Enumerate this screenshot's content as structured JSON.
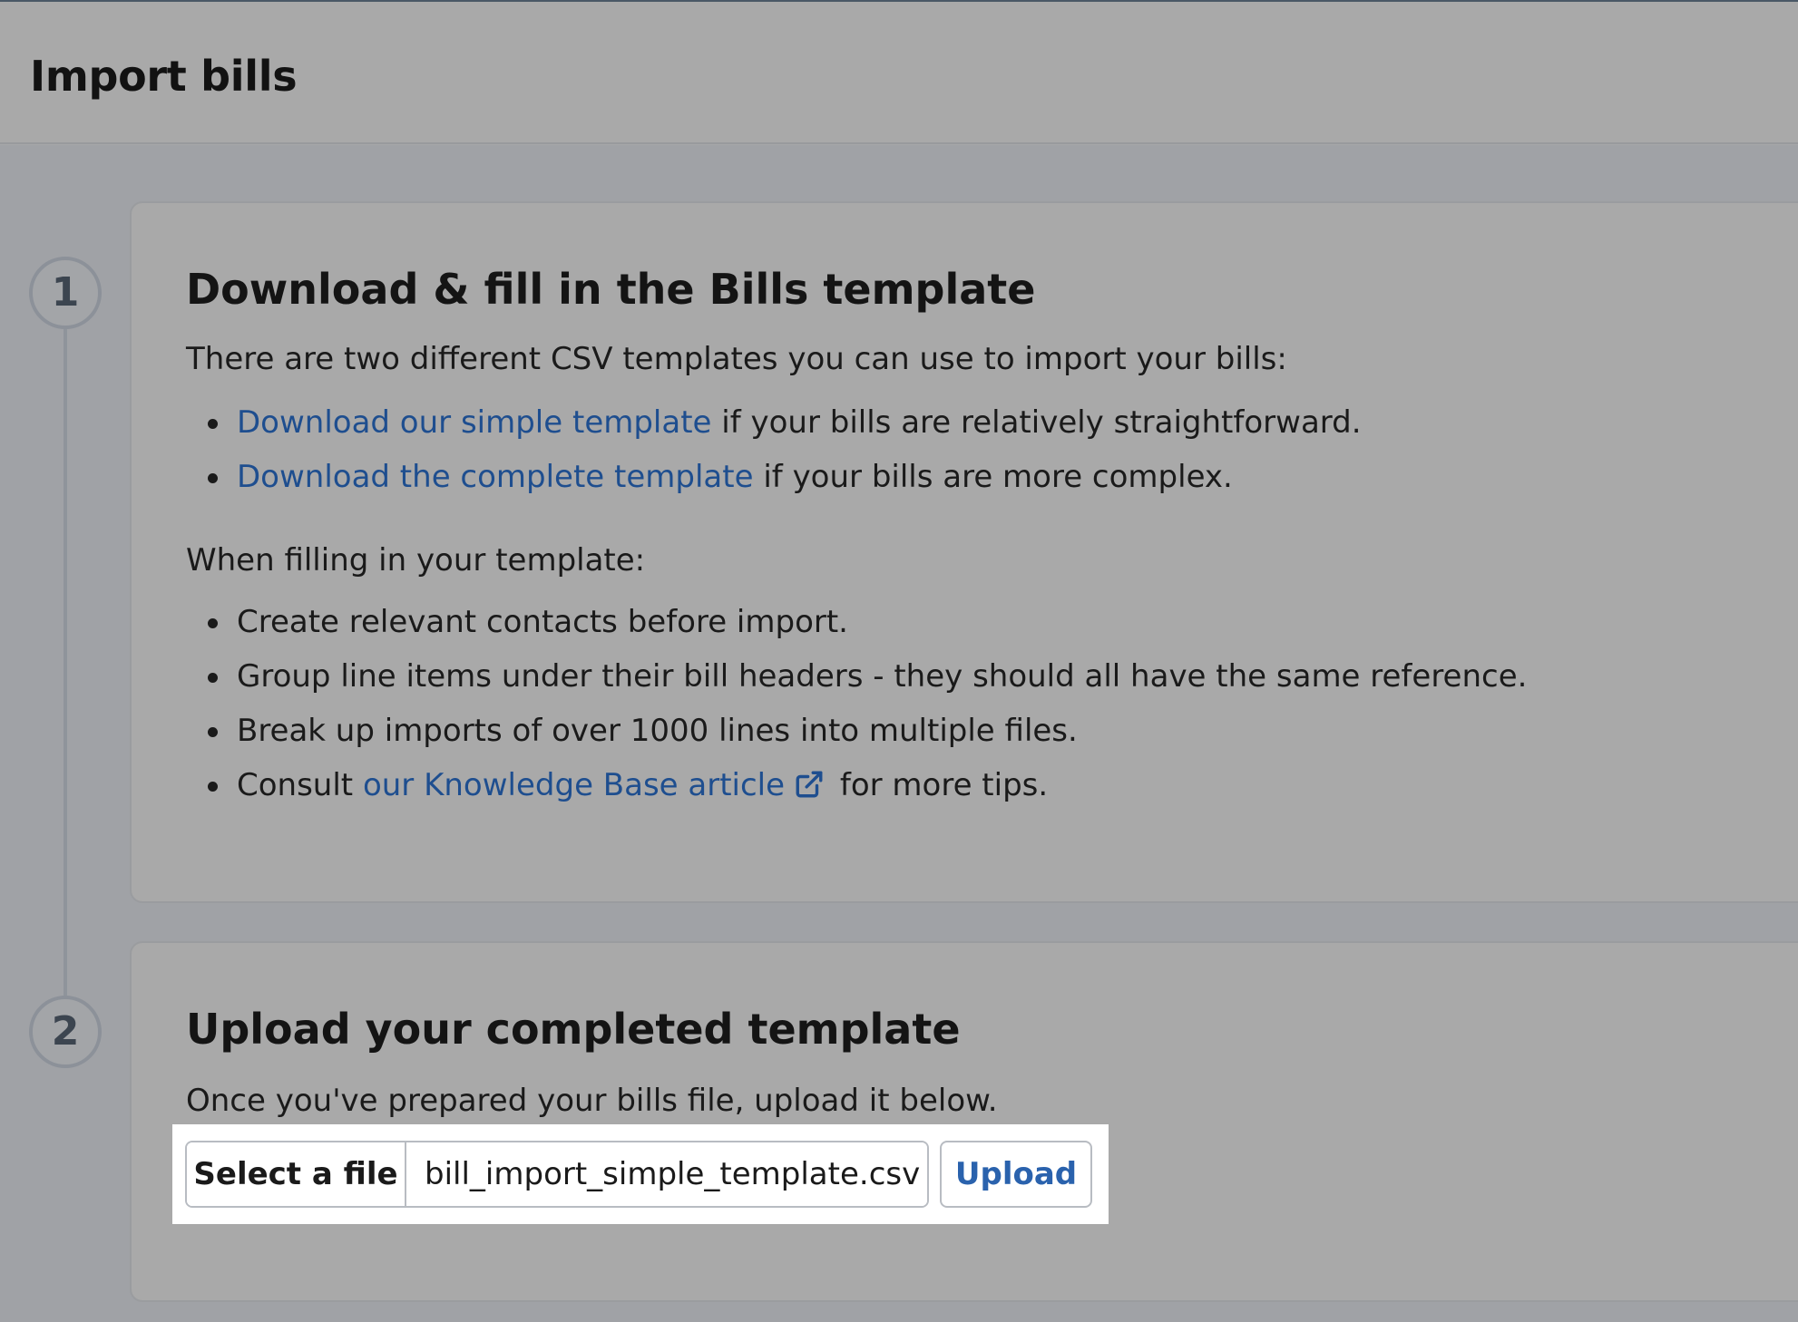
{
  "header": {
    "title": "Import bills"
  },
  "steps": [
    {
      "number": "1",
      "title": "Download & fill in the Bills template",
      "intro": "There are two different CSV templates you can use to import your bills:",
      "templates": [
        {
          "link": "Download our simple template",
          "text": " if your bills are relatively straightforward."
        },
        {
          "link": "Download the complete template",
          "text": " if your bills are more complex."
        }
      ],
      "filling_intro": "When filling in your template:",
      "tips": [
        "Create relevant contacts before import.",
        "Group line items under their bill headers - they should all have the same reference.",
        "Break up imports of over 1000 lines into multiple files."
      ],
      "consult": {
        "prefix": "Consult ",
        "link": "our Knowledge Base article",
        "suffix": " for more tips.",
        "icon": "external-link-icon"
      }
    },
    {
      "number": "2",
      "title": "Upload your completed template",
      "description": "Once you've prepared your bills file, upload it below.",
      "select_file_label": "Select a file",
      "file_name": "bill_import_simple_template.csv",
      "upload_label": "Upload"
    }
  ],
  "colors": {
    "link": "#1e4e8f",
    "upload_button_text": "#2a62ad"
  }
}
